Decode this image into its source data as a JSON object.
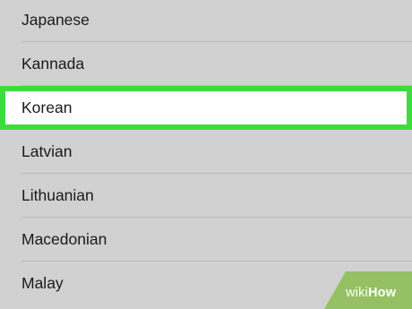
{
  "language_list": {
    "items": [
      {
        "label": "Japanese",
        "selected": false
      },
      {
        "label": "Kannada",
        "selected": false
      },
      {
        "label": "Korean",
        "selected": true
      },
      {
        "label": "Latvian",
        "selected": false
      },
      {
        "label": "Lithuanian",
        "selected": false
      },
      {
        "label": "Macedonian",
        "selected": false
      },
      {
        "label": "Malay",
        "selected": false
      }
    ]
  },
  "watermark": {
    "wiki": "wiki",
    "how": "How"
  },
  "colors": {
    "background": "#d1d1d1",
    "selected_background": "#ffffff",
    "highlight_border": "#3ddc3d",
    "separator": "#b9b9b9",
    "watermark_green": "#8fbf5a"
  }
}
